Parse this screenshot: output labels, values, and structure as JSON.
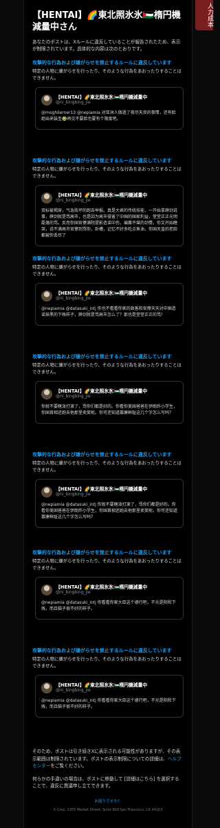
{
  "side_tab": "人力成本",
  "title": "【HENTAI】🌈東北照氷氷🇵🇸楕円機減量中さん",
  "intro": "あなたのポストは、Xルールに違反していることが報告されたため、表示が制限されています。具体的な内容は次のとおりです。",
  "rule_title": "攻撃的な行為および嫌がらせを禁止するルールに違反しています",
  "rule_desc": "特定の人物に嫌がらせを行ったり、そのような行為をあおったりすることはできません。",
  "tweet_name": "【HENTAI】🌈東北照氷氷🇵🇸楕円機減量中",
  "tweet_handle": "@ni_bingbing_jie",
  "tweets": [
    "@moghilerner13 @nepiamia 对亚洲人做過了夜尽天良的事情，还有脸跑出来装圣🤣再见不要脸也要有个限度吧。",
    "双标被揭穿，气急败坏的跑去举报。真是大君的传统技能，一开始拿薛剑说事，薛剑就是骂高市，也是因为高市侵害了中国的国家利益，堂堂正正光明磊落的骂。反而你国官僚满院提影造谣中伤，编篡不堪的剑情，你又开始瞎哭，说不满高市官僚到骂你，卧槽，记忆不好多吃点鱼油，你国天皇的老脸都被你丢尽了",
    "@nepiamia @datasuki_intj 你也不看看你家的政客和官僚天天对中国造谣抹黑的下贱样子，薛剑就是骂高市怎么了？那也是堂堂正正的骂！",
    "你就不要瞎泼打滚了，骂你们都是好的。你看你美国爸爸在伊朗炸小学生，你国首相还跑去他那里卖笑呢。你可还知道寡廉鲜耻这几个字怎么写吗？",
    "@nepiamia @datasuki_intj 你就不要瞎泼打滚了，骂你们都是好的。你看你美国爸爸在伊朗炸小学生，你国首相还跑去他那里卖笑呢。你可还知道寡廉鲜耻这几个字怎么写吗？",
    "@nepiamia @datasuki_intj 你看看你家大臣这个德行吧，不光是阴险下贱，而且脑子很不好的样子。",
    "@nepiamia @datasuki_intj 你看看你家大臣这个德行吧，不光是阴险下贱，而且脑子很不好的样子。"
  ],
  "outro_1": "そのため、ポストは引き続きXに表示される可能性がありますが、その表示範囲は制限されています。ポストの表示制限についての詳細は、",
  "help_center": "ヘルプセンター",
  "outro_1_end": "をご覧ください。",
  "outro_2": "何らかの手違いの場合は、ポストに移動して [詳細はこちら] を選択することで、違反に異議申し立てできます。",
  "help_link": "お困りですか？",
  "address": "X Corp. 1355 Market Street, Suite 900 San Francisco, CA 94103"
}
